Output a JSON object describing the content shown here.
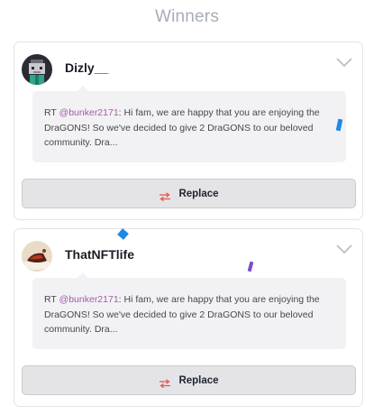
{
  "page": {
    "title": "Winners"
  },
  "winners": [
    {
      "username": "Dizly__",
      "tweet": {
        "prefix": "RT ",
        "mention": "@bunker2171",
        "text": ": Hi fam, we are happy that you are enjoying the DraGONS! So we've decided to give 2 DraGONS to our beloved community. Dra..."
      },
      "replace_label": "Replace",
      "avatar_icon": "pixel-character-avatar"
    },
    {
      "username": "ThatNFTlife",
      "tweet": {
        "prefix": "RT ",
        "mention": "@bunker2171",
        "text": ": Hi fam, we are happy that you are enjoying the DraGONS! So we've decided to give 2 DraGONS to our beloved community. Dra..."
      },
      "replace_label": "Replace",
      "avatar_icon": "cake-slice-avatar"
    }
  ],
  "icons": {
    "expand": "chevron-down-icon",
    "replace": "swap-arrows-icon"
  },
  "colors": {
    "replace_icon": "#e35a5a",
    "mention": "#a35aa6",
    "confetti_blue": "#1e88e5",
    "confetti_purple": "#7c4dcc"
  }
}
